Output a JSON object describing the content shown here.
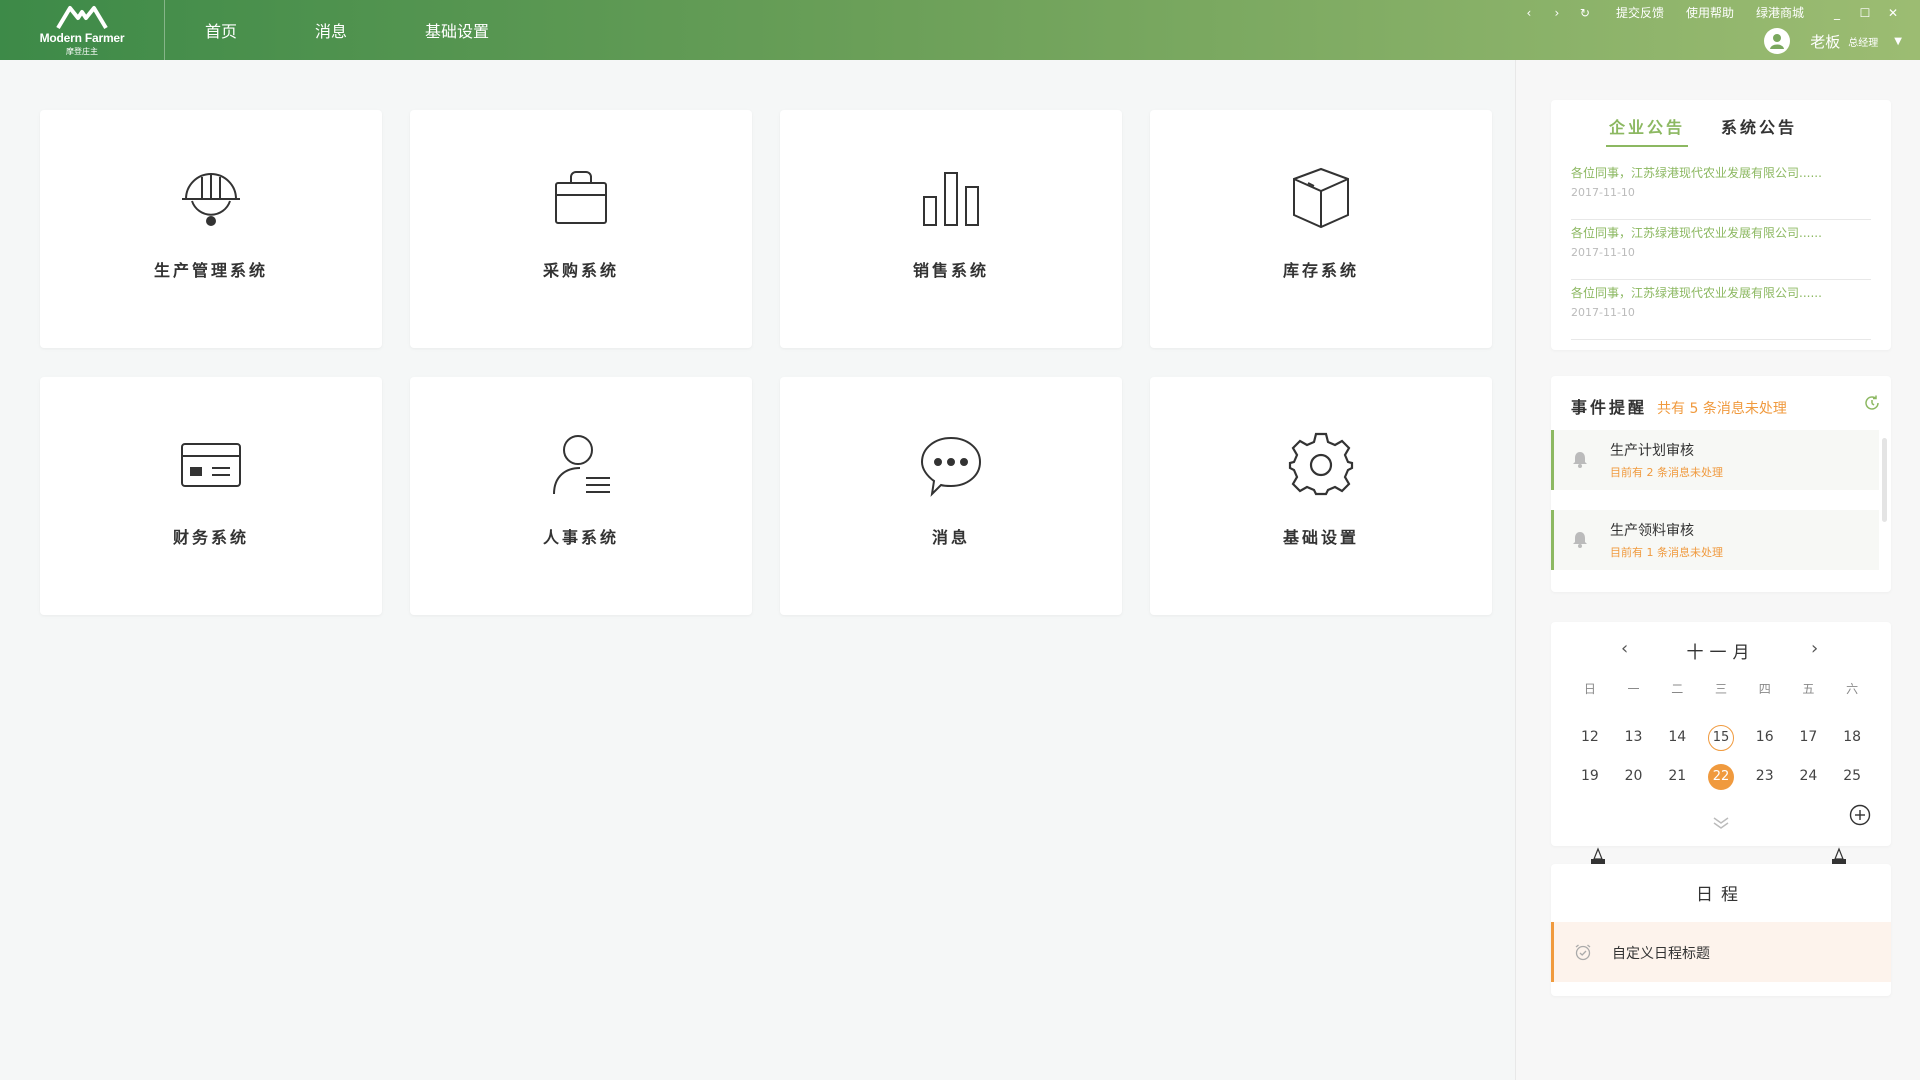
{
  "app": {
    "logo_text": "Modern Farmer",
    "logo_sub": "摩登庄主"
  },
  "nav": {
    "items": [
      {
        "label": "首页"
      },
      {
        "label": "消息"
      },
      {
        "label": "基础设置"
      }
    ]
  },
  "window_tools": {
    "feedback": "提交反馈",
    "help": "使用帮助",
    "mall": "绿港商城"
  },
  "user": {
    "name": "老板",
    "role": "总经理"
  },
  "modules": [
    {
      "label": "生产管理系统",
      "icon": "helmet-icon"
    },
    {
      "label": "采购系统",
      "icon": "shopping-bag-icon"
    },
    {
      "label": "销售系统",
      "icon": "bar-chart-icon"
    },
    {
      "label": "库存系统",
      "icon": "box-icon"
    },
    {
      "label": "财务系统",
      "icon": "card-icon"
    },
    {
      "label": "人事系统",
      "icon": "person-list-icon"
    },
    {
      "label": "消息",
      "icon": "chat-bubble-icon"
    },
    {
      "label": "基础设置",
      "icon": "gear-icon"
    }
  ],
  "notices": {
    "tabs": [
      "企业公告",
      "系统公告"
    ],
    "active_tab": "企业公告",
    "items": [
      {
        "title": "各位同事，江苏绿港现代农业发展有限公司......",
        "date": "2017-11-10"
      },
      {
        "title": "各位同事，江苏绿港现代农业发展有限公司......",
        "date": "2017-11-10"
      },
      {
        "title": "各位同事，江苏绿港现代农业发展有限公司......",
        "date": "2017-11-10"
      }
    ]
  },
  "events": {
    "title": "事件提醒",
    "summary": "共有 5 条消息未处理",
    "items": [
      {
        "name": "生产计划审核",
        "detail": "目前有  2  条消息未处理"
      },
      {
        "name": "生产领料审核",
        "detail": "目前有  1  条消息未处理"
      }
    ]
  },
  "calendar": {
    "month": "十一月",
    "weekdays": [
      "日",
      "一",
      "二",
      "三",
      "四",
      "五",
      "六"
    ],
    "weeks": [
      [
        "12",
        "13",
        "14",
        "15",
        "16",
        "17",
        "18"
      ],
      [
        "19",
        "20",
        "21",
        "22",
        "23",
        "24",
        "25"
      ]
    ],
    "today": "15",
    "selected": "22"
  },
  "schedule": {
    "title": "日程",
    "item_label": "自定义日程标题"
  },
  "colors": {
    "brand_green": "#8cb861",
    "accent_orange": "#f09a3e"
  }
}
